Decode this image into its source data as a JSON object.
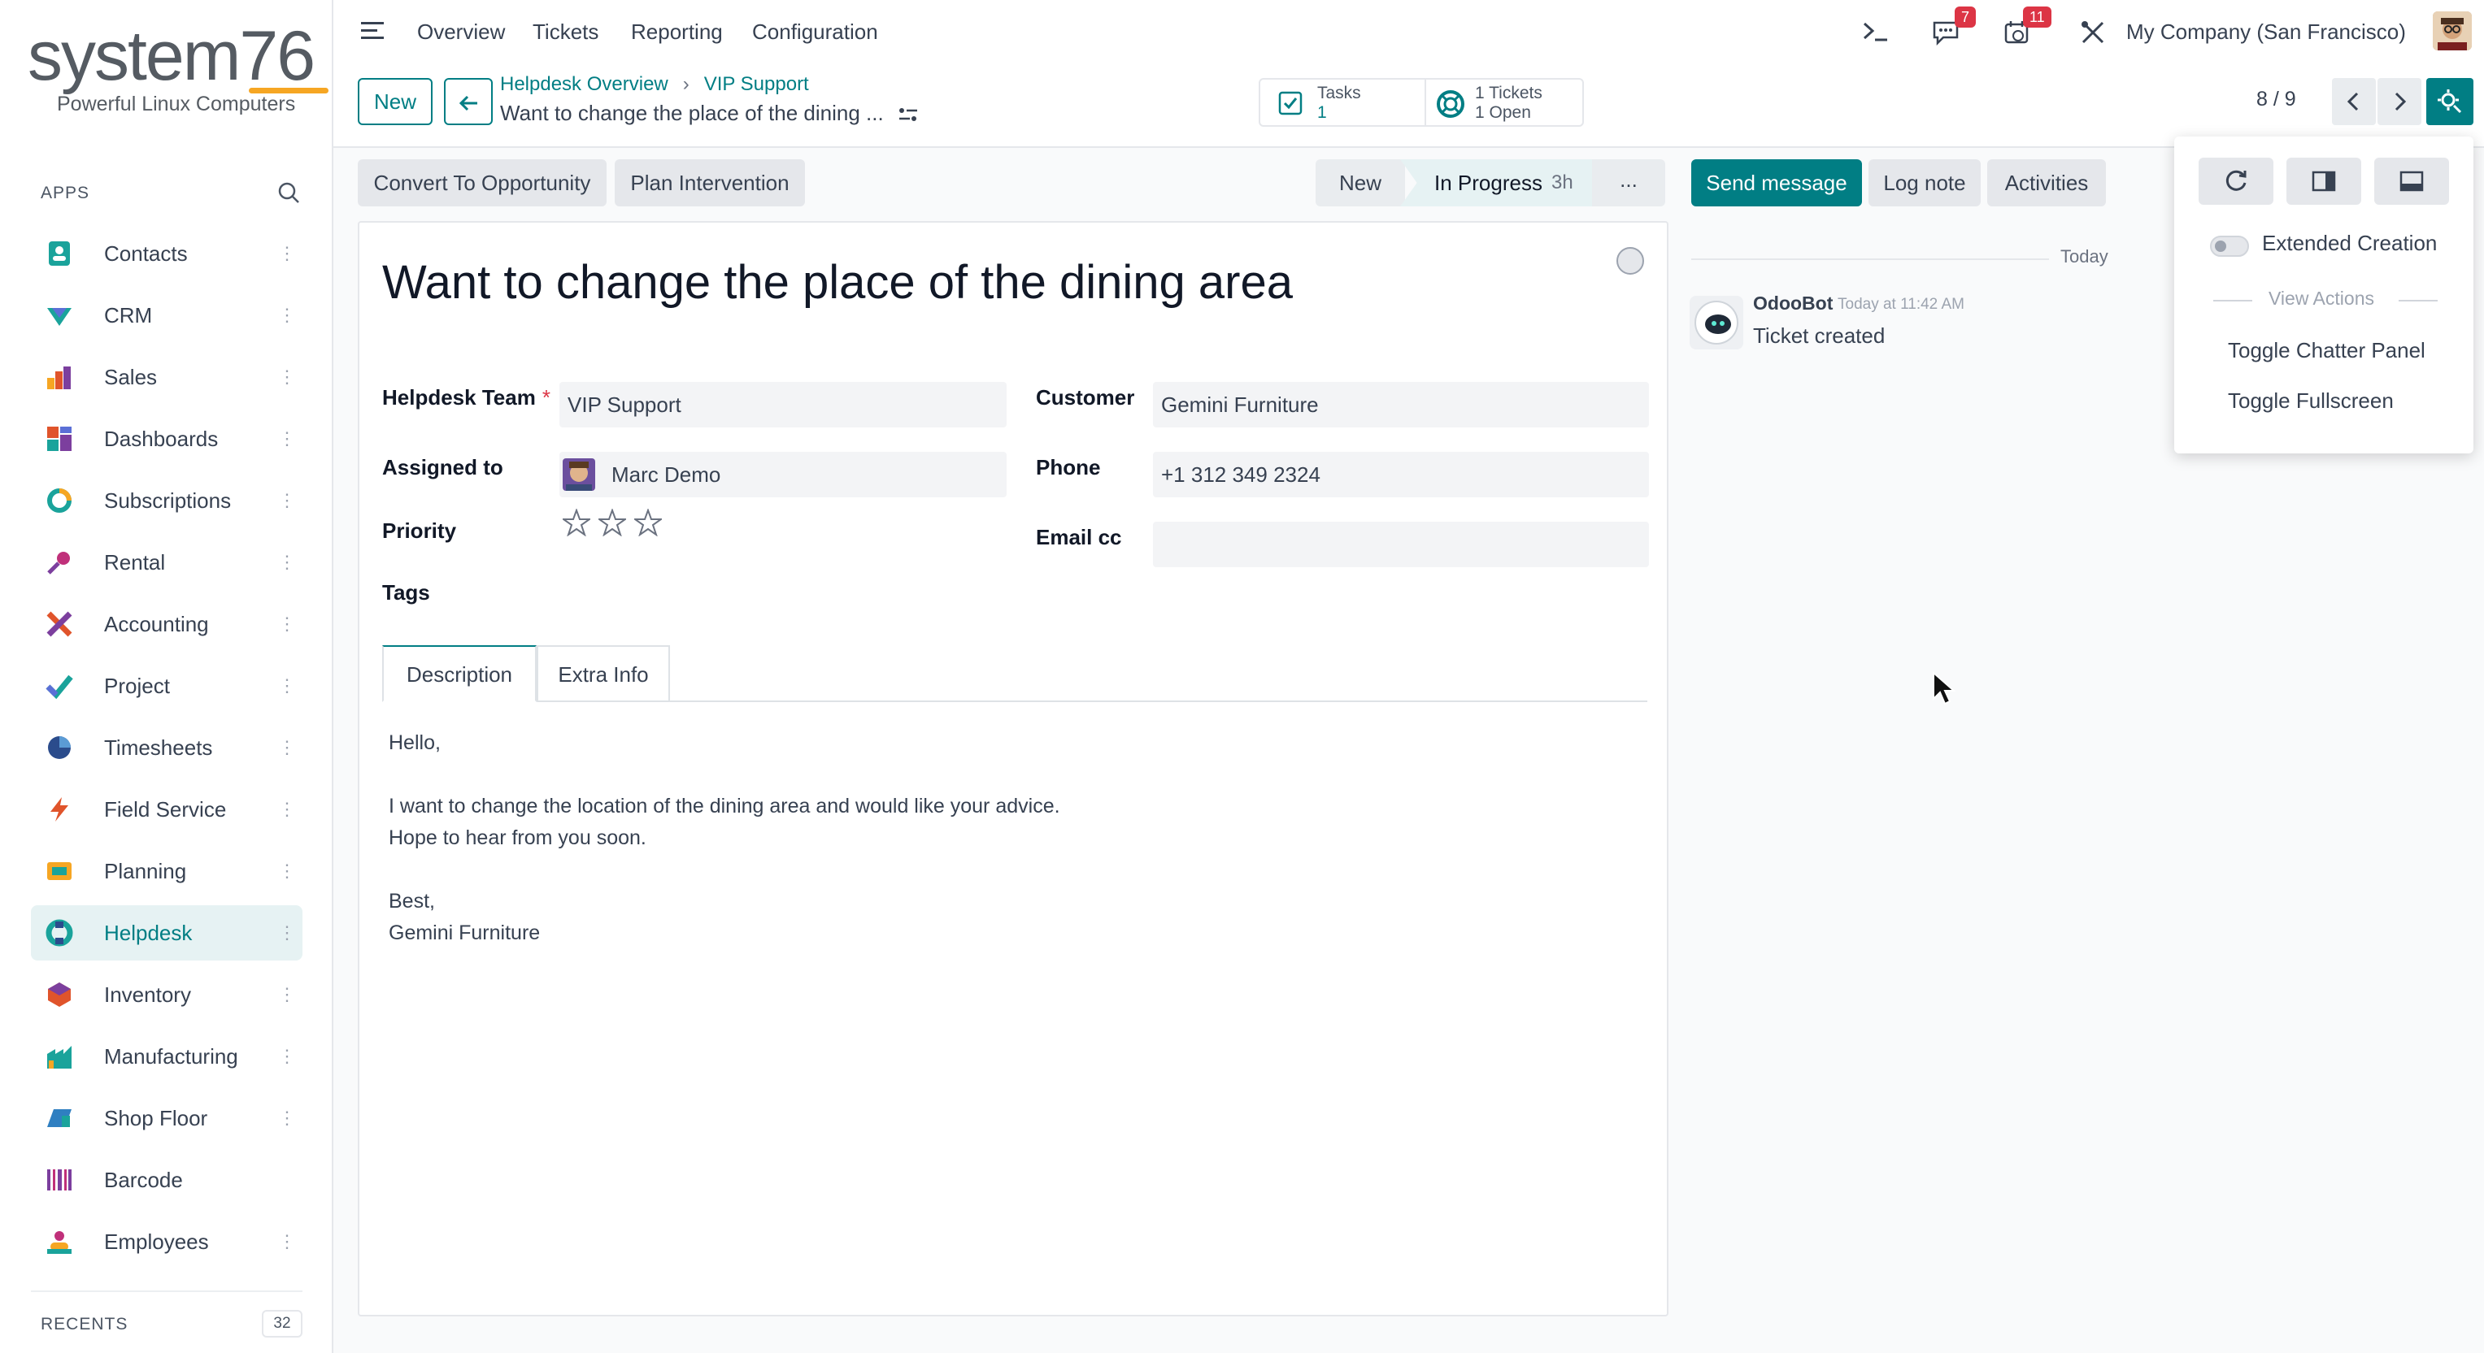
{
  "brand": {
    "logo_text": "system76",
    "tagline": "Powerful Linux Computers"
  },
  "sidebar": {
    "section_label": "APPS",
    "items": [
      {
        "label": "Contacts"
      },
      {
        "label": "CRM"
      },
      {
        "label": "Sales"
      },
      {
        "label": "Dashboards"
      },
      {
        "label": "Subscriptions"
      },
      {
        "label": "Rental"
      },
      {
        "label": "Accounting"
      },
      {
        "label": "Project"
      },
      {
        "label": "Timesheets"
      },
      {
        "label": "Field Service"
      },
      {
        "label": "Planning"
      },
      {
        "label": "Helpdesk"
      },
      {
        "label": "Inventory"
      },
      {
        "label": "Manufacturing"
      },
      {
        "label": "Shop Floor"
      },
      {
        "label": "Barcode"
      },
      {
        "label": "Employees"
      }
    ],
    "active_item": "Helpdesk",
    "recents_label": "RECENTS",
    "recents_count": "32"
  },
  "topbar": {
    "nav": [
      "Overview",
      "Tickets",
      "Reporting",
      "Configuration"
    ],
    "messages_badge": "7",
    "activities_badge": "11",
    "company": "My Company (San Francisco)"
  },
  "control": {
    "new_label": "New",
    "breadcrumb": [
      "Helpdesk Overview",
      "VIP Support"
    ],
    "record_title": "Want to change the place of the dining ...",
    "tasks": {
      "label": "Tasks",
      "value": "1"
    },
    "tickets": {
      "label": "1 Tickets",
      "value": "1 Open"
    },
    "pager": "8 / 9"
  },
  "actions": {
    "convert": "Convert To Opportunity",
    "plan": "Plan Intervention"
  },
  "stages": {
    "new": "New",
    "current": "In Progress",
    "current_duration": "3h",
    "more": "..."
  },
  "form": {
    "title": "Want to change the place of the dining area",
    "helpdesk_team_label": "Helpdesk Team",
    "required_mark": "*",
    "helpdesk_team": "VIP Support",
    "assigned_label": "Assigned to",
    "assigned": "Marc Demo",
    "priority_label": "Priority",
    "priority_stars": 0,
    "tags_label": "Tags",
    "customer_label": "Customer",
    "customer": "Gemini Furniture",
    "phone_label": "Phone",
    "phone": "+1 312 349 2324",
    "email_cc_label": "Email cc",
    "email_cc": "",
    "tabs": [
      "Description",
      "Extra Info"
    ],
    "description": [
      "Hello,",
      "I want to change the location of the dining area and would like your advice.",
      "Hope to hear from you soon.",
      "Best,",
      "Gemini Furniture"
    ]
  },
  "chatter": {
    "send_message": "Send message",
    "log_note": "Log note",
    "activities": "Activities",
    "date_separator": "Today",
    "message": {
      "author": "OdooBot",
      "time": "Today at 11:42 AM",
      "body": "Ticket created"
    }
  },
  "panel": {
    "extended_creation": "Extended Creation",
    "view_actions": "View Actions",
    "toggle_chatter": "Toggle Chatter Panel",
    "toggle_fullscreen": "Toggle Fullscreen"
  },
  "colors": {
    "accent": "#017e84",
    "badge": "#dc3545",
    "logo_underline": "#f6a623"
  }
}
